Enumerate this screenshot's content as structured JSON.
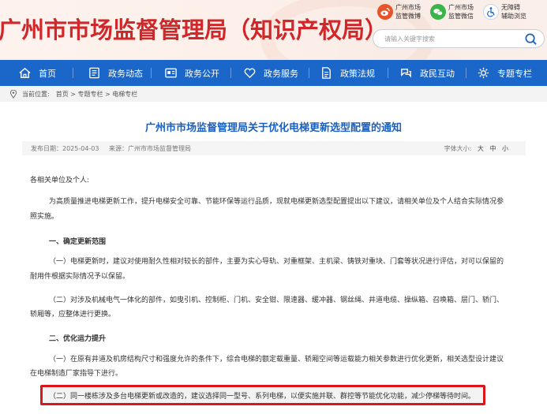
{
  "header": {
    "title": "广州市市场监督管理局（知识产权局）",
    "links": [
      {
        "label_line1": "广州市场",
        "label_line2": "监管微博",
        "icon": "weibo-icon",
        "color": "#e8542a"
      },
      {
        "label_line1": "广州市场",
        "label_line2": "监管微信",
        "icon": "wechat-icon",
        "color": "#3bb44a"
      },
      {
        "label_line1": "无障碍",
        "label_line2": "辅助浏览",
        "icon": "accessibility-icon",
        "color": "#1b66c9"
      }
    ],
    "search_placeholder": "请输入关键字搜索"
  },
  "nav": {
    "items": [
      {
        "label": "首页",
        "icon": "home-icon"
      },
      {
        "label": "政务动态",
        "icon": "news-icon"
      },
      {
        "label": "政务公开",
        "icon": "open-icon"
      },
      {
        "label": "政务服务",
        "icon": "heart-icon"
      },
      {
        "label": "政策法规",
        "icon": "document-icon"
      },
      {
        "label": "政民互动",
        "icon": "interaction-icon"
      },
      {
        "label": "专题专栏",
        "icon": "gear-icon"
      }
    ],
    "background": "#1b66c9"
  },
  "breadcrumb": {
    "prefix": "当前位置:",
    "path": "首页 > 专题专栏 > 电梯专栏"
  },
  "article": {
    "title": "广州市市场监督管理局关于优化电梯更新选型配置的通知",
    "date": "发布日期：2025-04-03",
    "source": "来源：广州市市场监督管理局",
    "font_size_label": "字体大小:",
    "font_sizes": [
      "大",
      "中",
      "小"
    ],
    "greeting": "各相关单位及个人:",
    "intro_line1": "为高质量推进电梯更新工作，提升电梯安全可靠、节能环保等运行品质，现就电梯更新选型配置提出以下建议，请相关单位及个人结合实际情况参",
    "intro_line2": "照实施。",
    "section1": "一、确定更新范围",
    "s1p1_line1": "（一）电梯更新时，建议对使用耐久性相对较长的部件，主要为实心导轨、对重框架、主机梁、铸铁对重块、门套等状况进行评估，对可以保留的",
    "s1p1_line2": "耐用件根据实际情况予以保留。",
    "s1p2_line1": "（二）对涉及机械电气一体化的部件，如曳引机、控制柜、门机、安全钳、限速器、缓冲器、钢丝绳、井道电缆、操纵箱、召唤箱、层门、轿门、",
    "s1p2_line2": "轿厢等，应整体进行更换。",
    "section2": "二、优化运力提升",
    "s2p1_line1": "（一）在原有井道及机房结构尺寸和强度允许的条件下，综合电梯的额定载重量、轿厢空间等运载能力相关参数进行优化更新，相关选型设计建议",
    "s2p1_line2": "在电梯制造厂家指导下进行。",
    "s2p2": "（二）同一楼栋涉及多台电梯更新或改造的，建议选择同一型号、系列电梯，以便实施并联、群控等节能优化功能，减少停梯等待时间。",
    "title_color": "#1b5fbf",
    "highlight_color": "#d9161b"
  }
}
